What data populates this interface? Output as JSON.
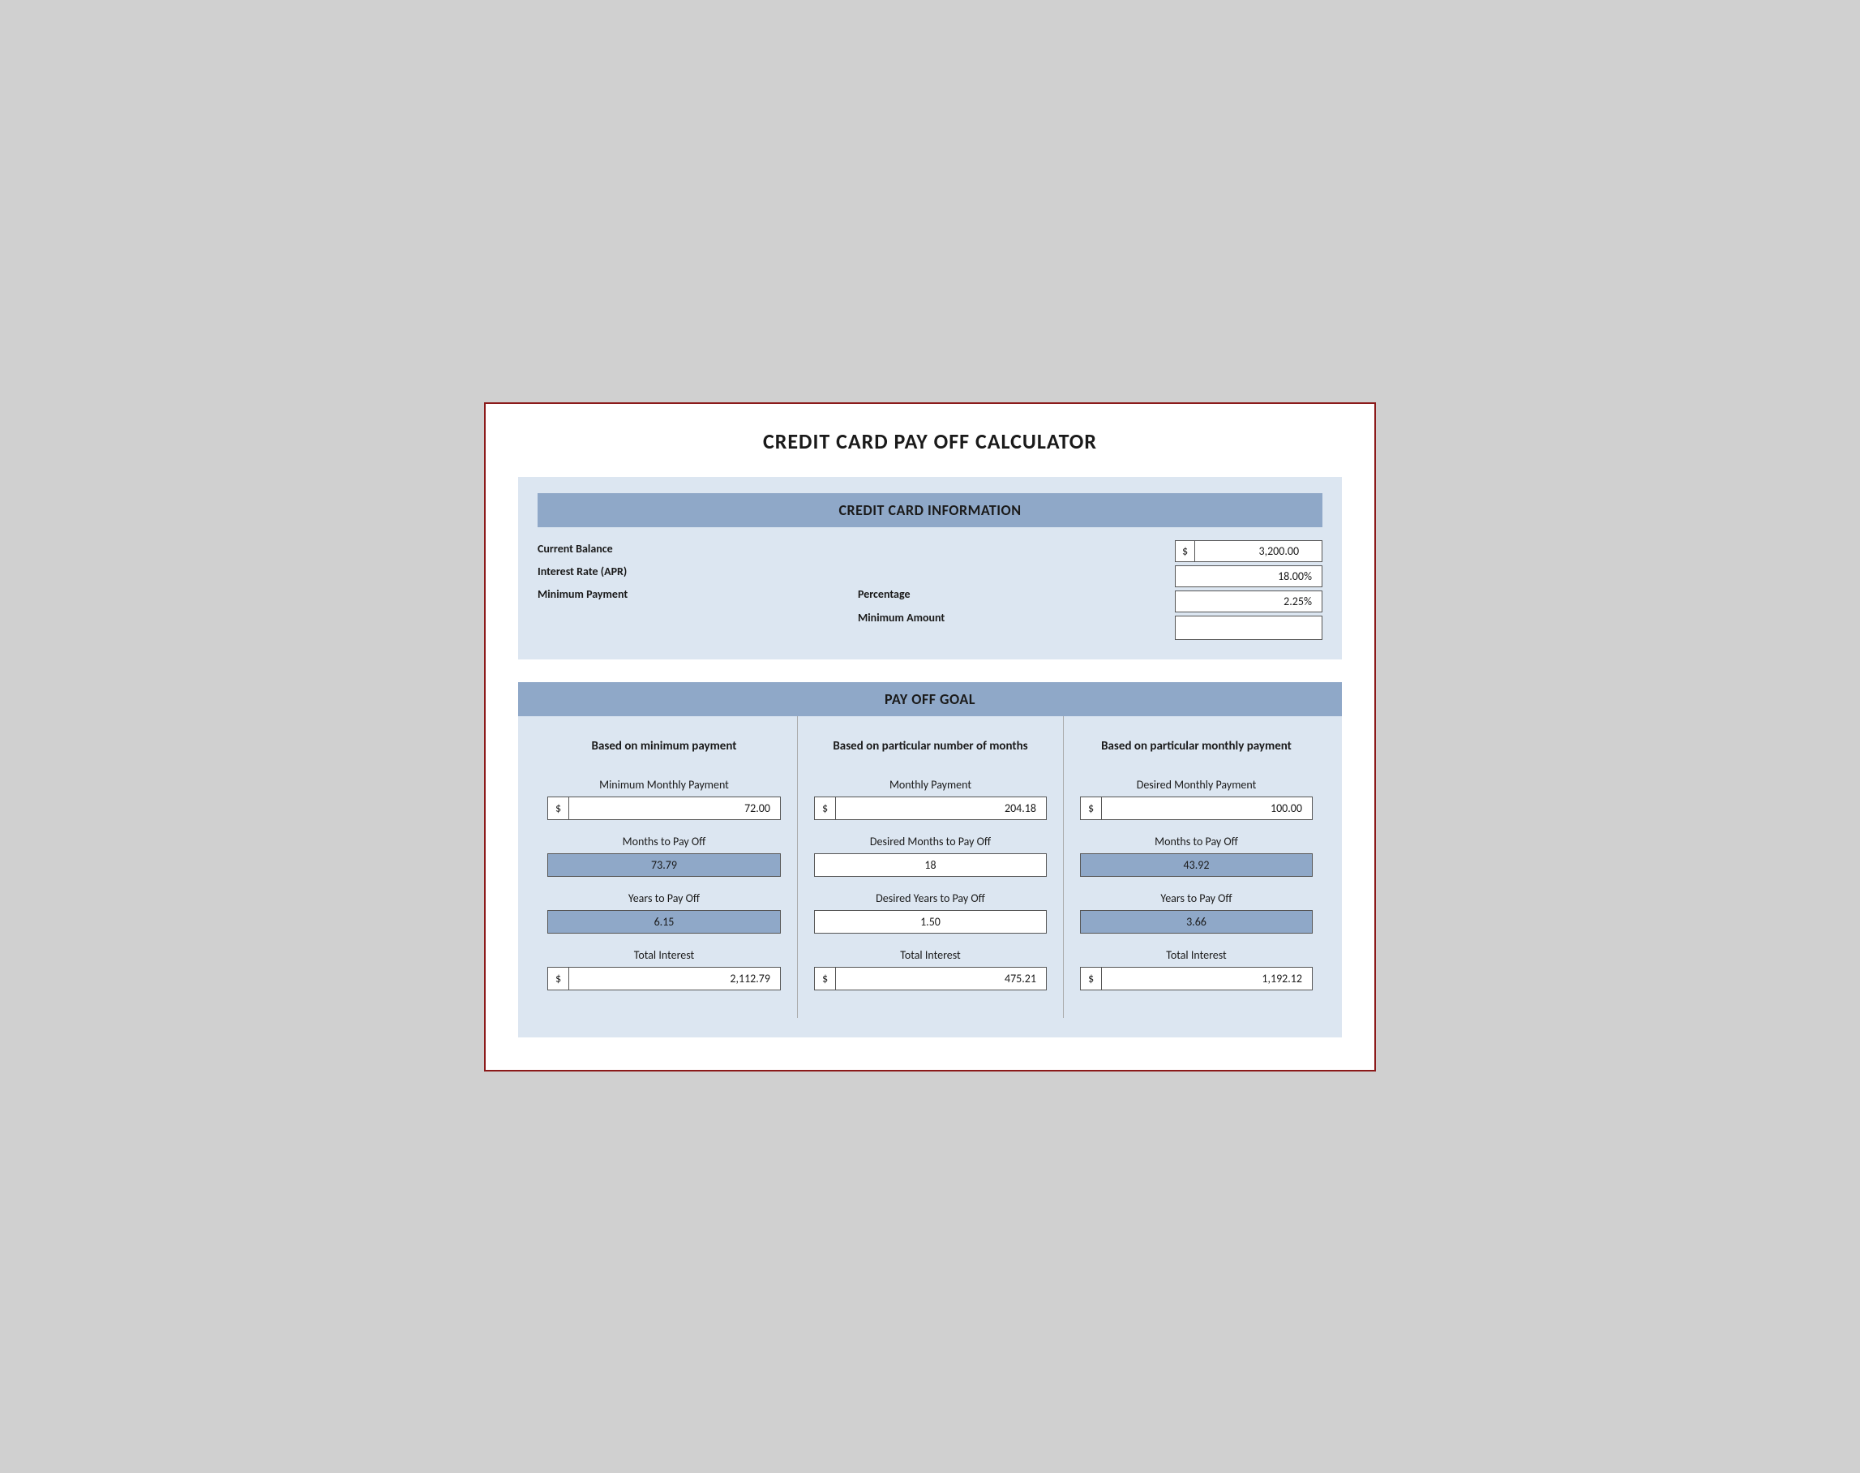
{
  "page": {
    "title": "CREDIT CARD PAY OFF CALCULATOR",
    "cc_info": {
      "section_header": "CREDIT CARD INFORMATION",
      "labels": {
        "balance": "Current Balance",
        "interest": "Interest Rate (APR)",
        "min_payment": "Minimum Payment",
        "percentage": "Percentage",
        "min_amount": "Minimum Amount"
      },
      "values": {
        "balance_dollar": "$",
        "balance_value": "3,200.00",
        "interest_value": "18.00%",
        "min_pct_value": "2.25%",
        "min_amount_value": ""
      }
    },
    "payoff_goal": {
      "section_header": "PAY OFF GOAL",
      "columns": [
        {
          "title": "Based on minimum payment",
          "fields": [
            {
              "label": "Minimum Monthly Payment",
              "type": "dollar_input",
              "dollar": "$",
              "value": "72.00"
            },
            {
              "label": "Months to Pay Off",
              "type": "result_blue",
              "value": "73.79"
            },
            {
              "label": "Years to Pay Off",
              "type": "result_blue",
              "value": "6.15"
            },
            {
              "label": "Total Interest",
              "type": "dollar_input",
              "dollar": "$",
              "value": "2,112.79"
            }
          ]
        },
        {
          "title": "Based on particular number of months",
          "fields": [
            {
              "label": "Monthly Payment",
              "type": "dollar_input",
              "dollar": "$",
              "value": "204.18"
            },
            {
              "label": "Desired Months to Pay Off",
              "type": "result_white",
              "value": "18"
            },
            {
              "label": "Desired Years to Pay Off",
              "type": "result_white",
              "value": "1.50"
            },
            {
              "label": "Total Interest",
              "type": "dollar_input",
              "dollar": "$",
              "value": "475.21"
            }
          ]
        },
        {
          "title": "Based on particular monthly payment",
          "fields": [
            {
              "label": "Desired Monthly Payment",
              "type": "dollar_input",
              "dollar": "$",
              "value": "100.00"
            },
            {
              "label": "Months to Pay Off",
              "type": "result_blue",
              "value": "43.92"
            },
            {
              "label": "Years to Pay Off",
              "type": "result_blue",
              "value": "3.66"
            },
            {
              "label": "Total Interest",
              "type": "dollar_input",
              "dollar": "$",
              "value": "1,192.12"
            }
          ]
        }
      ]
    }
  }
}
